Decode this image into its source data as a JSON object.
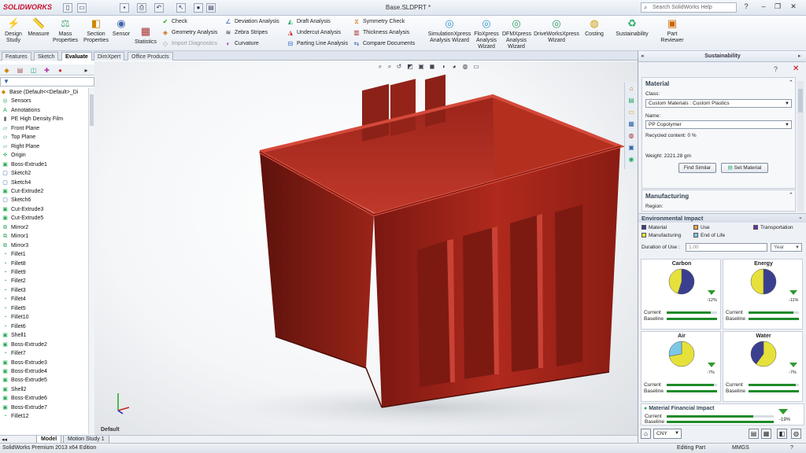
{
  "app": {
    "logo": "SOLIDWORKS",
    "document_title": "Base.SLDPRT *",
    "search_placeholder": "Search SolidWorks Help"
  },
  "ribbon": {
    "design_study": "Design Study",
    "measure": "Measure",
    "mass_properties": "Mass Properties",
    "section_properties": "Section Properties",
    "sensor": "Sensor",
    "statistics": "Statistics",
    "check": "Check",
    "geometry_analysis": "Geometry Analysis",
    "import_diagnostics": "Import Diagnostics",
    "deviation_analysis": "Deviation Analysis",
    "zebra_stripes": "Zebra Stripes",
    "curvature": "Curvature",
    "draft_analysis": "Draft Analysis",
    "undercut_analysis": "Undercut Analysis",
    "parting_line_analysis": "Parting Line Analysis",
    "symmetry_check": "Symmetry Check",
    "thickness_analysis": "Thickness Analysis",
    "compare_documents": "Compare Documents",
    "simulationxpress": "SimulationXpress Analysis Wizard",
    "floxpress": "FloXpress Analysis Wizard",
    "dfmxpress": "DFMXpress Analysis Wizard",
    "driveworksxpress": "DriveWorksXpress Wizard",
    "costing": "Costing",
    "sustainability": "Sustainability",
    "part_reviewer": "Part Reviewer"
  },
  "tabs": [
    "Features",
    "Sketch",
    "Evaluate",
    "DimXpert",
    "Office Products"
  ],
  "active_tab": "Evaluate",
  "tree": {
    "root": "Base (Default<<Default>_Di",
    "items": [
      "Sensors",
      "Annotations",
      "PE High Density Film",
      "Front Plane",
      "Top Plane",
      "Right Plane",
      "Origin",
      "Boss-Extrude1",
      "Sketch2",
      "Sketch4",
      "Cut-Extrude2",
      "Sketch6",
      "Cut-Extrude3",
      "Cut-Extrude5",
      "Mirror2",
      "Mirror1",
      "Mirror3",
      "Fillet1",
      "Fillet8",
      "Fillet9",
      "Fillet2",
      "Fillet3",
      "Fillet4",
      "Fillet5",
      "Fillet10",
      "Fillet6",
      "Shell1",
      "Boss-Extrude2",
      "Fillet7",
      "Boss-Extrude3",
      "Boss-Extrude4",
      "Boss-Extrude5",
      "Shell2",
      "Boss-Extrude6",
      "Boss-Extrude7",
      "Fillet12"
    ]
  },
  "viewport": {
    "view_label": "Default",
    "model_color": "#a4251b"
  },
  "bottom_tabs": [
    "Model",
    "Motion Study 1"
  ],
  "status": {
    "edition": "SolidWorks Premium 2013 x64 Edition",
    "mode": "Editing Part",
    "units": "MMGS"
  },
  "panel": {
    "title": "Sustainability",
    "material": {
      "heading": "Material",
      "class_label": "Class:",
      "class_value": "Custom Materials : Custom Plastics",
      "name_label": "Name:",
      "name_value": "PP Copolymer",
      "recycled": "Recycled content: 0 %",
      "weight": "Weight:   2221.28 gm",
      "find_similar": "Find Similar",
      "set_material": "Set Material"
    },
    "manufacturing": {
      "heading": "Manufacturing",
      "region_label": "Region:"
    },
    "env": {
      "heading": "Environmental Impact",
      "legend": [
        {
          "label": "Material",
          "color": "#3b3f8f"
        },
        {
          "label": "Use",
          "color": "#e8a24a"
        },
        {
          "label": "Transportation",
          "color": "#6a2fa0"
        },
        {
          "label": "Manufacturing",
          "color": "#e6e13a"
        },
        {
          "label": "End of Life",
          "color": "#7cc8e6"
        }
      ],
      "duration_label": "Duration of Use :",
      "duration_value": "1.00",
      "duration_unit": "Year",
      "current_label": "Current",
      "baseline_label": "Baseline",
      "cells": [
        {
          "title": "Carbon",
          "pct": "-12%",
          "current": 0.88,
          "baseline": 1.0
        },
        {
          "title": "Energy",
          "pct": "-11%",
          "current": 0.89,
          "baseline": 1.0
        },
        {
          "title": "Air",
          "pct": "-7%",
          "current": 0.93,
          "baseline": 1.0
        },
        {
          "title": "Water",
          "pct": "-7%",
          "current": 0.93,
          "baseline": 1.0
        }
      ]
    },
    "financial": {
      "heading": "Material Financial Impact",
      "pct": "-19%",
      "current": 0.81
    },
    "currency": "CNY"
  }
}
